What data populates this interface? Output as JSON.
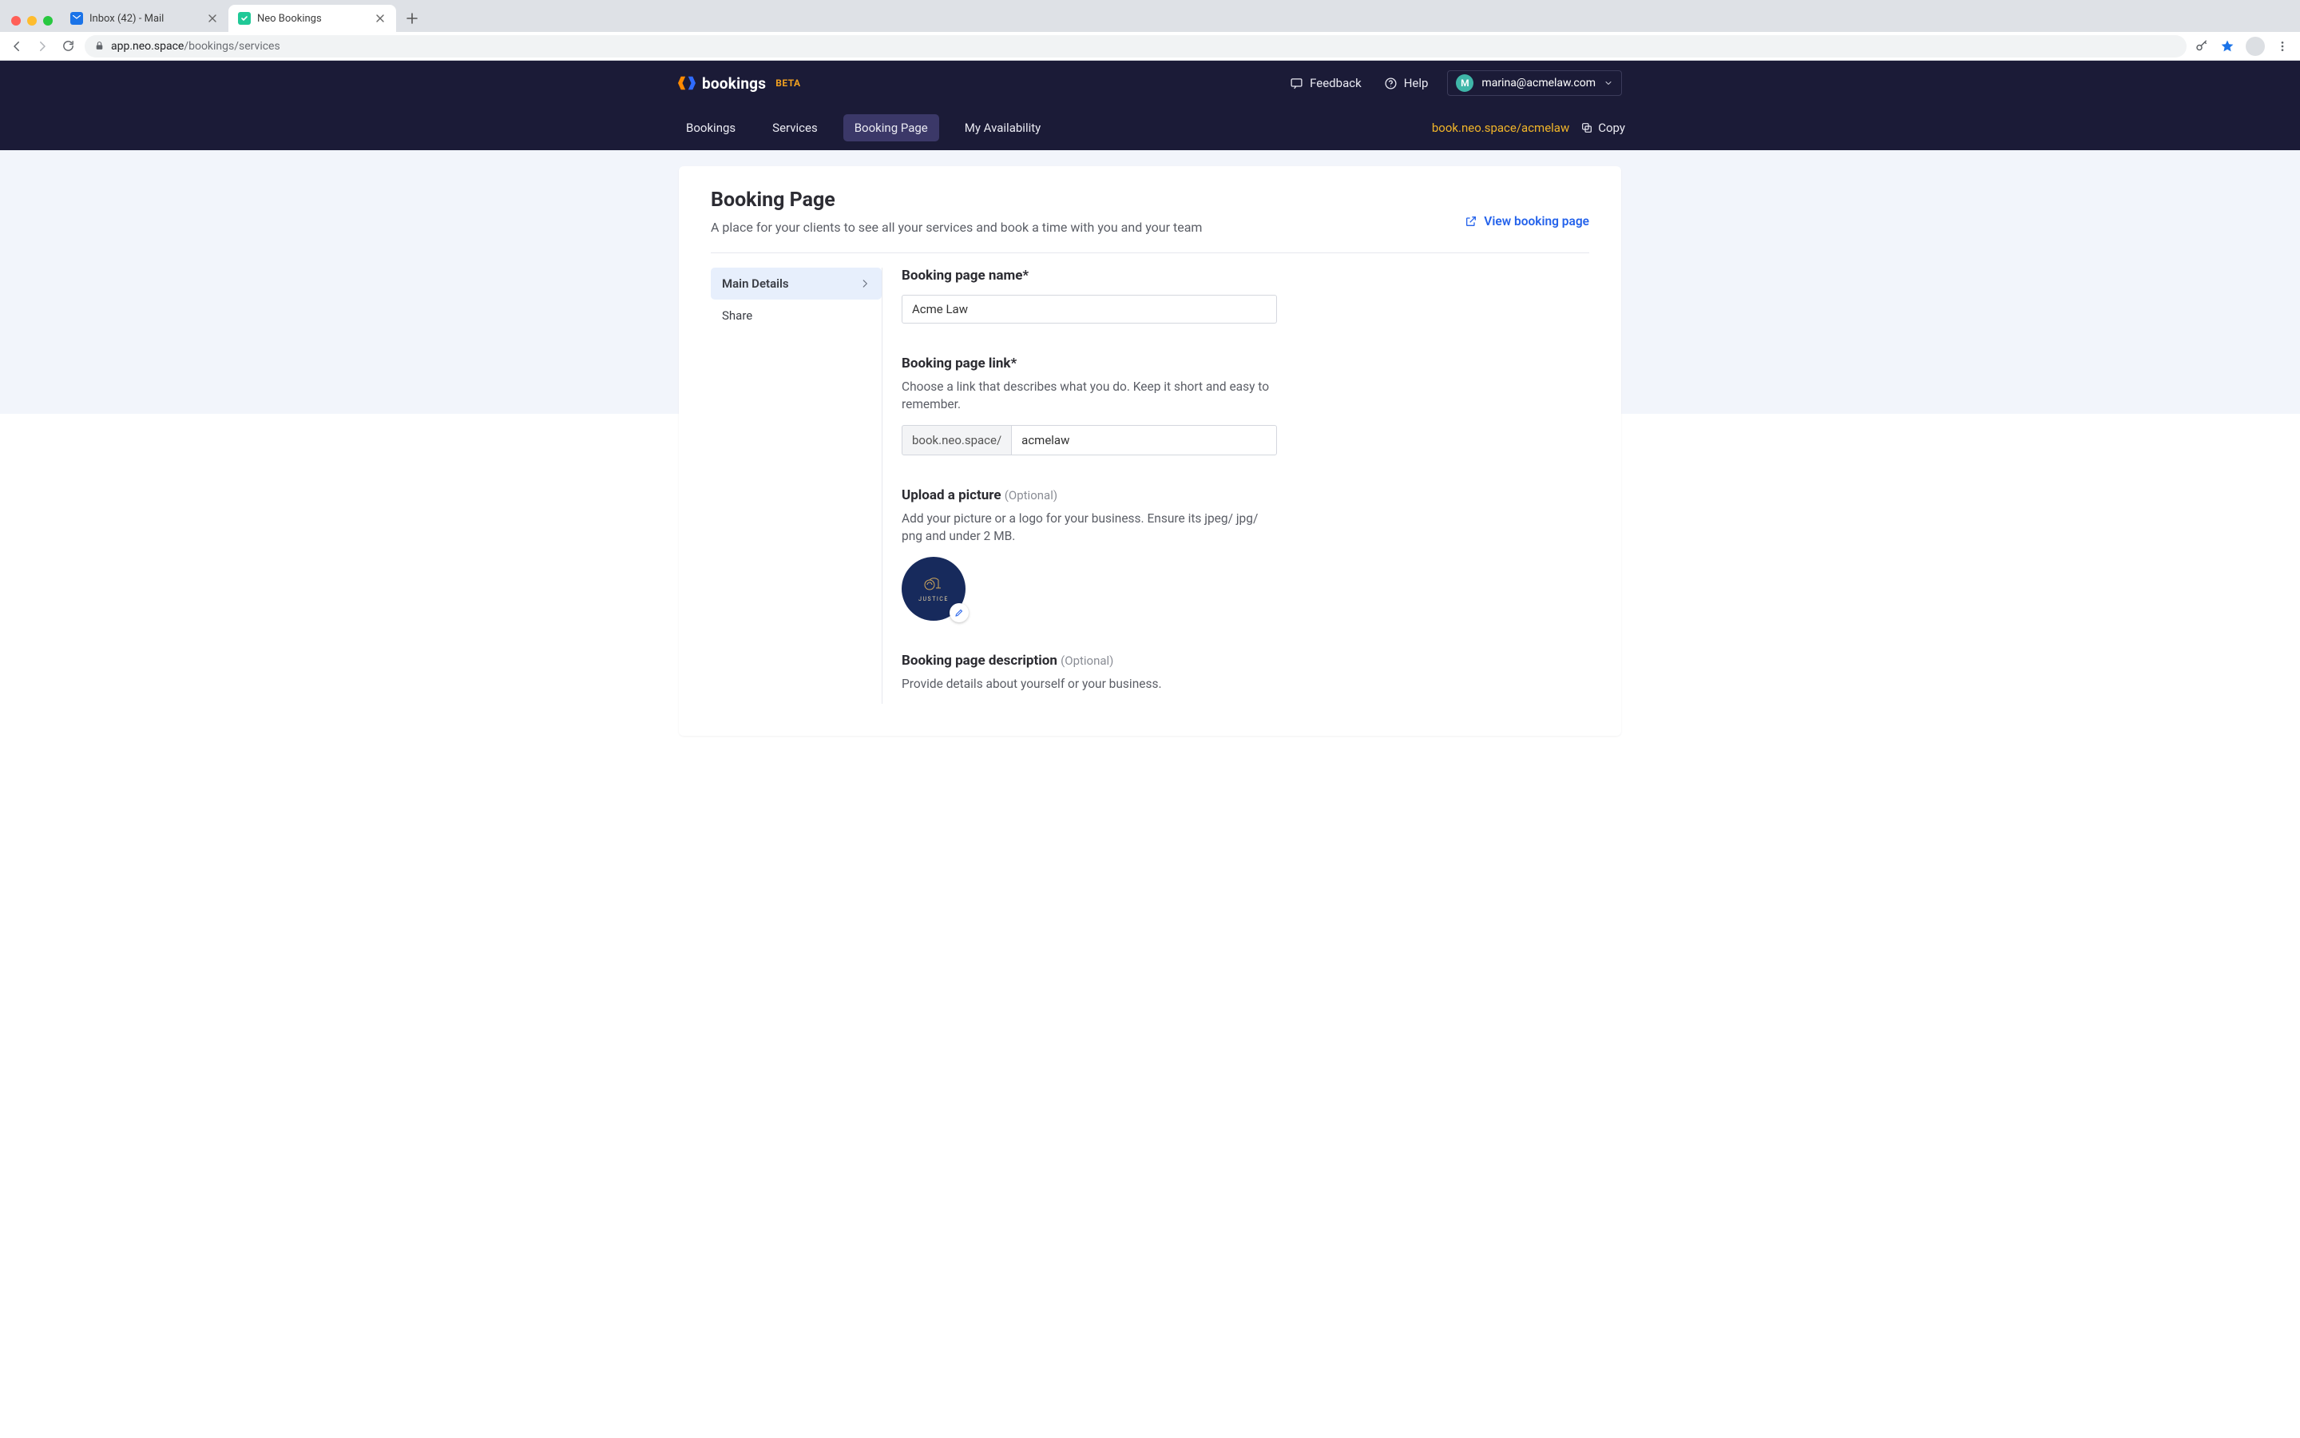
{
  "browser": {
    "tabs": [
      {
        "title": "Inbox (42) - Mail",
        "active": false
      },
      {
        "title": "Neo Bookings",
        "active": true
      }
    ],
    "url_host": "app.neo.space",
    "url_path": "/bookings/services"
  },
  "header": {
    "brand": "bookings",
    "beta": "BETA",
    "feedback": "Feedback",
    "help": "Help",
    "account_initial": "M",
    "account_email": "marina@acmelaw.com"
  },
  "nav": {
    "tabs": [
      "Bookings",
      "Services",
      "Booking Page",
      "My Availability"
    ],
    "active_index": 2,
    "booking_url": "book.neo.space/acmelaw",
    "copy_label": "Copy"
  },
  "page": {
    "title": "Booking Page",
    "subtitle": "A place for your clients to see all your services and book a time with you and your team",
    "view_link": "View booking page"
  },
  "sidebar": {
    "items": [
      "Main Details",
      "Share"
    ],
    "active_index": 0
  },
  "form": {
    "name": {
      "label": "Booking page name*",
      "value": "Acme Law"
    },
    "link": {
      "label": "Booking page link*",
      "help": "Choose a link that describes what you do. Keep it short and easy to remember.",
      "prefix": "book.neo.space/",
      "value": "acmelaw"
    },
    "picture": {
      "label": "Upload a picture",
      "optional": "(Optional)",
      "help": "Add your picture or a logo for your business. Ensure its jpeg/ jpg/ png and under 2 MB.",
      "logo_text": "JUSTICE"
    },
    "description": {
      "label": "Booking page description",
      "optional": "(Optional)",
      "help": "Provide details about yourself or your business."
    }
  }
}
